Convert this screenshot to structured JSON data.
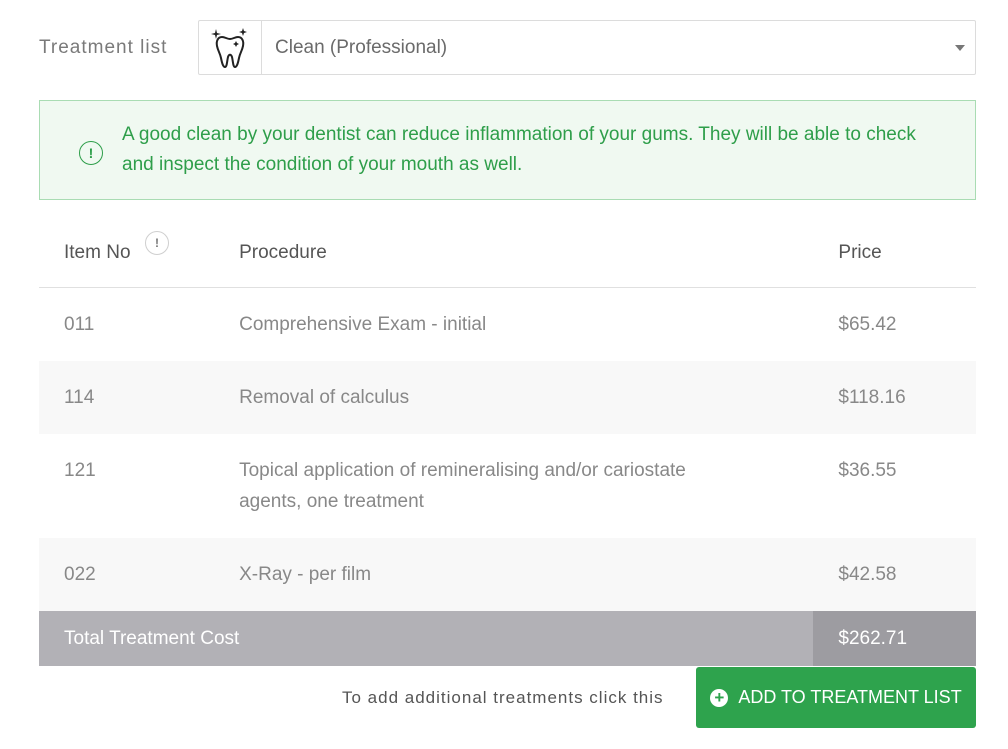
{
  "picker": {
    "label": "Treatment list",
    "selected": "Clean (Professional)",
    "icon": "tooth-sparkle-icon"
  },
  "alert": {
    "icon": "exclamation-circle-icon",
    "text": "A good clean by your dentist can reduce inflammation of your gums. They will be able to check and inspect the condition of your mouth as well.",
    "color": "#2e9e4a"
  },
  "table": {
    "headers": {
      "item_no": "Item No",
      "procedure": "Procedure",
      "price": "Price"
    },
    "info_badge": "!",
    "rows": [
      {
        "item_no": "011",
        "procedure": "Comprehensive Exam - initial",
        "price": "$65.42"
      },
      {
        "item_no": "114",
        "procedure": "Removal of calculus",
        "price": "$118.16"
      },
      {
        "item_no": "121",
        "procedure": "Topical application of remineralising and/or cariostate agents, one treatment",
        "price": "$36.55"
      },
      {
        "item_no": "022",
        "procedure": "X-Ray - per film",
        "price": "$42.58"
      }
    ],
    "total_label": "Total Treatment Cost",
    "total_value": "$262.71"
  },
  "footer": {
    "note": "To add additional treatments click this",
    "button_label": "ADD TO TREATMENT LIST",
    "button_color": "#2ea34d"
  }
}
